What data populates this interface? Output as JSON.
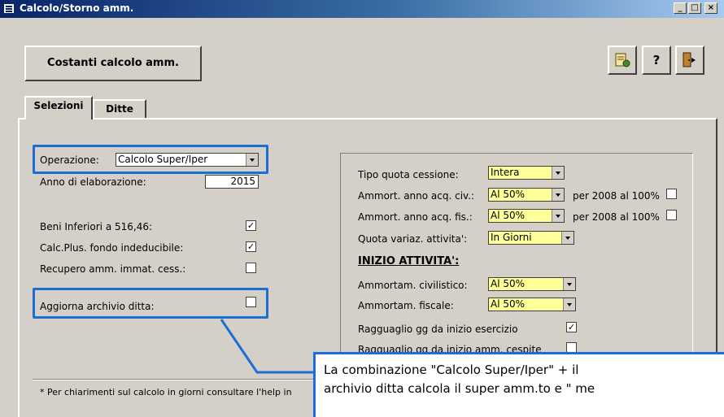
{
  "window": {
    "title": "Calcolo/Storno amm.",
    "controls": [
      "_",
      "□",
      "×"
    ]
  },
  "toolbar": {
    "constants_button": "Costanti calcolo amm.",
    "tool_icons": [
      "run-icon",
      "help-icon",
      "exit-door-icon"
    ],
    "help_glyph": "?"
  },
  "tabs": [
    {
      "label": "Selezioni",
      "active": true
    },
    {
      "label": "Ditte",
      "active": false
    }
  ],
  "left": {
    "operazione_label": "Operazione:",
    "operazione_value": "Calcolo Super/Iper",
    "anno_label": "Anno di elaborazione:",
    "anno_value": "2015",
    "checks": [
      {
        "label": "Beni Inferiori a 516,46:",
        "checked": true
      },
      {
        "label": "Calc.Plus. fondo indeducibile:",
        "checked": true
      },
      {
        "label": "Recupero amm. immat. cess.:",
        "checked": false
      },
      {
        "label": "Aggiorna archivio ditta:",
        "checked": false
      }
    ],
    "footer_note": "* Per chiarimenti sul calcolo in giorni consultare l'help in"
  },
  "right": {
    "rows": [
      {
        "label": "Tipo quota cessione:",
        "value": "Intera"
      },
      {
        "label": "Ammort. anno acq. civ.:",
        "value": "Al 50%",
        "extra": "per 2008 al 100%",
        "extra_checked": false
      },
      {
        "label": "Ammort. anno acq. fis.:",
        "value": "Al 50%",
        "extra": "per 2008 al 100%",
        "extra_checked": false
      },
      {
        "label": "Quota variaz. attivita':",
        "value": "In Giorni"
      }
    ],
    "section_title": "INIZIO ATTIVITA':",
    "section_rows": [
      {
        "label": "Ammortam. civilistico:",
        "value": "Al 50%"
      },
      {
        "label": "Ammortam. fiscale:",
        "value": "Al 50%"
      }
    ],
    "checks": [
      {
        "label": "Ragguaglio gg da inizio esercizio",
        "checked": true
      },
      {
        "label": "Ragguaglio gg da inizio amm. cespite",
        "checked": false
      }
    ]
  },
  "callout": {
    "line1": "La combinazione \"Calcolo Super/Iper\" + il",
    "line2": "archivio ditta calcola il super amm.to e \" me"
  },
  "colors": {
    "highlight": "#1a6fd6",
    "field_yellow": "#ffff99",
    "face": "#d4d0c8"
  }
}
